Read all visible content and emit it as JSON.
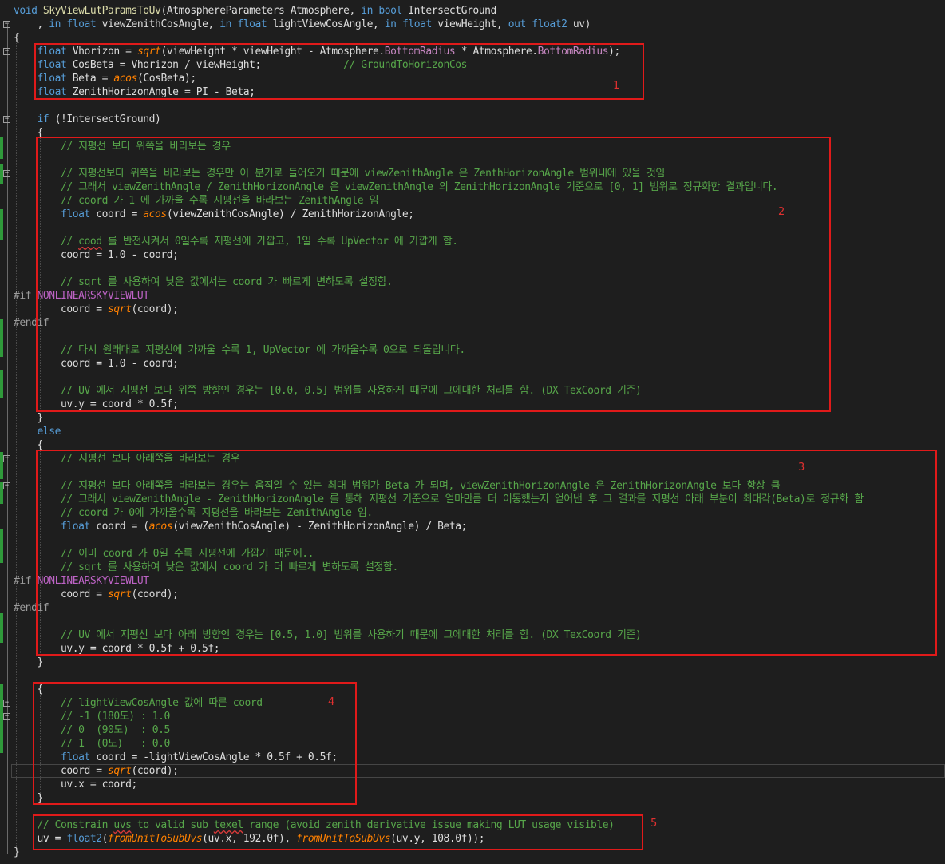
{
  "editor": {
    "theme": {
      "background": "#1e1e1e",
      "keyword": "#569cd6",
      "comment": "#57a64a",
      "function": "#dcdcaa",
      "highlight_box": "#e01a1a",
      "change_marker": "#2f9a3a"
    },
    "lines": [
      {
        "tokens": [
          [
            "kw",
            "void "
          ],
          [
            "fn",
            "SkyViewLutParamsToUv"
          ],
          [
            "plain",
            "(AtmosphereParameters Atmosphere, "
          ],
          [
            "kw",
            "in "
          ],
          [
            "kw",
            "bool "
          ],
          [
            "plain",
            "IntersectGround"
          ]
        ]
      },
      {
        "tokens": [
          [
            "plain",
            "    , "
          ],
          [
            "kw",
            "in "
          ],
          [
            "kw",
            "float "
          ],
          [
            "plain",
            "viewZenithCosAngle, "
          ],
          [
            "kw",
            "in "
          ],
          [
            "kw",
            "float "
          ],
          [
            "plain",
            "lightViewCosAngle, "
          ],
          [
            "kw",
            "in "
          ],
          [
            "kw",
            "float "
          ],
          [
            "plain",
            "viewHeight, "
          ],
          [
            "kw",
            "out "
          ],
          [
            "kw",
            "float2 "
          ],
          [
            "plain",
            "uv)"
          ]
        ]
      },
      {
        "tokens": [
          [
            "plain",
            "{"
          ]
        ]
      },
      {
        "tokens": [
          [
            "kw",
            "    float "
          ],
          [
            "plain",
            "Vhorizon = "
          ],
          [
            "fni",
            "sqrt"
          ],
          [
            "plain",
            "(viewHeight * viewHeight - Atmosphere."
          ],
          [
            "prop",
            "BottomRadius"
          ],
          [
            "plain",
            " * Atmosphere."
          ],
          [
            "prop",
            "BottomRadius"
          ],
          [
            "plain",
            ");"
          ]
        ]
      },
      {
        "tokens": [
          [
            "kw",
            "    float "
          ],
          [
            "plain",
            "CosBeta = Vhorizon / viewHeight;              "
          ],
          [
            "cm",
            "// GroundToHorizonCos"
          ]
        ]
      },
      {
        "tokens": [
          [
            "kw",
            "    float "
          ],
          [
            "plain",
            "Beta = "
          ],
          [
            "fni",
            "acos"
          ],
          [
            "plain",
            "(CosBeta);"
          ]
        ]
      },
      {
        "tokens": [
          [
            "kw",
            "    float "
          ],
          [
            "plain",
            "ZenithHorizonAngle = PI - Beta;"
          ]
        ]
      },
      {
        "tokens": []
      },
      {
        "tokens": [
          [
            "kw",
            "    if "
          ],
          [
            "plain",
            "(!IntersectGround)"
          ]
        ]
      },
      {
        "tokens": [
          [
            "plain",
            "    {"
          ]
        ]
      },
      {
        "tokens": [
          [
            "cm",
            "        // 지평선 보다 위쪽을 바라보는 경우"
          ]
        ]
      },
      {
        "tokens": []
      },
      {
        "tokens": [
          [
            "cm",
            "        // 지평선보다 위쪽을 바라보는 경우만 이 분기로 들어오기 때문에 viewZenithAngle 은 ZenthHorizonAngle 범위내에 있을 것임"
          ]
        ]
      },
      {
        "tokens": [
          [
            "cm",
            "        // 그래서 viewZenithAngle / ZenithHorizonAngle 은 viewZenithAngle 의 ZenithHorizonAngle 기준으로 [0, 1] 범위로 정규화한 결과입니다."
          ]
        ]
      },
      {
        "tokens": [
          [
            "cm",
            "        // coord 가 1 에 가까울 수록 지평선을 바라보는 ZenithAngle 임"
          ]
        ]
      },
      {
        "tokens": [
          [
            "kw",
            "        float "
          ],
          [
            "plain",
            "coord = "
          ],
          [
            "fni",
            "acos"
          ],
          [
            "plain",
            "(viewZenithCosAngle) / ZenithHorizonAngle;"
          ]
        ]
      },
      {
        "tokens": []
      },
      {
        "tokens": [
          [
            "cm",
            "        // "
          ],
          [
            "cmsq",
            "cood"
          ],
          [
            "cm",
            " 를 반전시켜서 0일수록 지평선에 가깝고, 1일 수록 UpVector 에 가깝게 함."
          ]
        ]
      },
      {
        "tokens": [
          [
            "plain",
            "        coord = 1.0 - coord;"
          ]
        ]
      },
      {
        "tokens": []
      },
      {
        "tokens": [
          [
            "cm",
            "        // sqrt 를 사용하여 낮은 값에서는 coord 가 빠르게 변하도록 설정함."
          ]
        ]
      },
      {
        "tokens": [
          [
            "pp",
            "#if "
          ],
          [
            "macro",
            "NONLINEARSKYVIEWLUT"
          ]
        ]
      },
      {
        "tokens": [
          [
            "plain",
            "        coord = "
          ],
          [
            "fni",
            "sqrt"
          ],
          [
            "plain",
            "(coord);"
          ]
        ]
      },
      {
        "tokens": [
          [
            "pp",
            "#endif"
          ]
        ]
      },
      {
        "tokens": []
      },
      {
        "tokens": [
          [
            "cm",
            "        // 다시 원래대로 지평선에 가까울 수록 1, UpVector 에 가까울수록 0으로 되돌립니다."
          ]
        ]
      },
      {
        "tokens": [
          [
            "plain",
            "        coord = 1.0 - coord;"
          ]
        ]
      },
      {
        "tokens": []
      },
      {
        "tokens": [
          [
            "cm",
            "        // UV 에서 지평선 보다 위쪽 방향인 경우는 [0.0, 0.5] 범위를 사용하게 때문에 그에대한 처리를 함. (DX TexCoord 기준)"
          ]
        ]
      },
      {
        "tokens": [
          [
            "plain",
            "        uv.y = coord * 0.5f;"
          ]
        ]
      },
      {
        "tokens": [
          [
            "plain",
            "    }"
          ]
        ]
      },
      {
        "tokens": [
          [
            "kw",
            "    else"
          ]
        ]
      },
      {
        "tokens": [
          [
            "plain",
            "    {"
          ]
        ]
      },
      {
        "tokens": [
          [
            "cm",
            "        // 지평선 보다 아래쪽을 바라보는 경우"
          ]
        ]
      },
      {
        "tokens": []
      },
      {
        "tokens": [
          [
            "cm",
            "        // 지평선 보다 아래쪽을 바라보는 경우는 움직일 수 있는 최대 범위가 Beta 가 되며, viewZenithHorizonAngle 은 ZenithHorizonAngle 보다 항상 큼"
          ]
        ]
      },
      {
        "tokens": [
          [
            "cm",
            "        // 그래서 viewZenithAngle - ZenithHorizonAngle 를 통해 지평선 기준으로 얼마만큼 더 이동했는지 얻어낸 후 그 결과를 지평선 아래 부분이 최대각(Beta)로 정규화 함"
          ]
        ]
      },
      {
        "tokens": [
          [
            "cm",
            "        // coord 가 0에 가까울수록 지평선을 바라보는 ZenithAngle 임."
          ]
        ]
      },
      {
        "tokens": [
          [
            "kw",
            "        float "
          ],
          [
            "plain",
            "coord = ("
          ],
          [
            "fni",
            "acos"
          ],
          [
            "plain",
            "(viewZenithCosAngle) - ZenithHorizonAngle) / Beta;"
          ]
        ]
      },
      {
        "tokens": []
      },
      {
        "tokens": [
          [
            "cm",
            "        // 이미 coord 가 0일 수록 지평선에 가깝기 때문에.."
          ]
        ]
      },
      {
        "tokens": [
          [
            "cm",
            "        // sqrt 를 사용하여 낮은 값에서 coord 가 더 빠르게 변하도록 설정함."
          ]
        ]
      },
      {
        "tokens": [
          [
            "pp",
            "#if "
          ],
          [
            "macro",
            "NONLINEARSKYVIEWLUT"
          ]
        ]
      },
      {
        "tokens": [
          [
            "plain",
            "        coord = "
          ],
          [
            "fni",
            "sqrt"
          ],
          [
            "plain",
            "(coord);"
          ]
        ]
      },
      {
        "tokens": [
          [
            "pp",
            "#endif"
          ]
        ]
      },
      {
        "tokens": []
      },
      {
        "tokens": [
          [
            "cm",
            "        // UV 에서 지평선 보다 아래 방향인 경우는 [0.5, 1.0] 범위를 사용하기 때문에 그에대한 처리를 함. (DX TexCoord 기준)"
          ]
        ]
      },
      {
        "tokens": [
          [
            "plain",
            "        uv.y = coord * 0.5f + 0.5f;"
          ]
        ]
      },
      {
        "tokens": [
          [
            "plain",
            "    }"
          ]
        ]
      },
      {
        "tokens": []
      },
      {
        "tokens": [
          [
            "plain",
            "    {"
          ]
        ]
      },
      {
        "tokens": [
          [
            "cm",
            "        // lightViewCosAngle 값에 따른 coord"
          ]
        ]
      },
      {
        "tokens": [
          [
            "cm",
            "        // -1 (180도) : 1.0"
          ]
        ]
      },
      {
        "tokens": [
          [
            "cm",
            "        // 0  (90도)  : 0.5"
          ]
        ]
      },
      {
        "tokens": [
          [
            "cm",
            "        // 1  (0도)   : 0.0"
          ]
        ]
      },
      {
        "tokens": [
          [
            "kw",
            "        float "
          ],
          [
            "plain",
            "coord = -lightViewCosAngle * 0.5f + 0.5f;"
          ]
        ]
      },
      {
        "tokens": [
          [
            "plain",
            "        coord = "
          ],
          [
            "fni",
            "sqrt"
          ],
          [
            "plain",
            "(coord);"
          ]
        ]
      },
      {
        "tokens": [
          [
            "plain",
            "        uv.x = coord;"
          ]
        ]
      },
      {
        "tokens": [
          [
            "plain",
            "    }"
          ]
        ]
      },
      {
        "tokens": []
      },
      {
        "tokens": [
          [
            "cm",
            "    // Constrain "
          ],
          [
            "cmsq",
            "uvs"
          ],
          [
            "cm",
            " to valid sub "
          ],
          [
            "cmsq",
            "texel"
          ],
          [
            "cm",
            " range (avoid zenith derivative issue making LUT usage visible)"
          ]
        ]
      },
      {
        "tokens": [
          [
            "plain",
            "    uv = "
          ],
          [
            "kw",
            "float2"
          ],
          [
            "plain",
            "("
          ],
          [
            "fni",
            "fromUnitToSubUvs"
          ],
          [
            "plain",
            "(uv.x, 192.0f), "
          ],
          [
            "fni",
            "fromUnitToSubUvs"
          ],
          [
            "plain",
            "(uv.y, 108.0f));"
          ]
        ]
      },
      {
        "tokens": [
          [
            "plain",
            "}"
          ]
        ]
      }
    ],
    "annotations": [
      "1",
      "2",
      "3",
      "4",
      "5"
    ]
  }
}
